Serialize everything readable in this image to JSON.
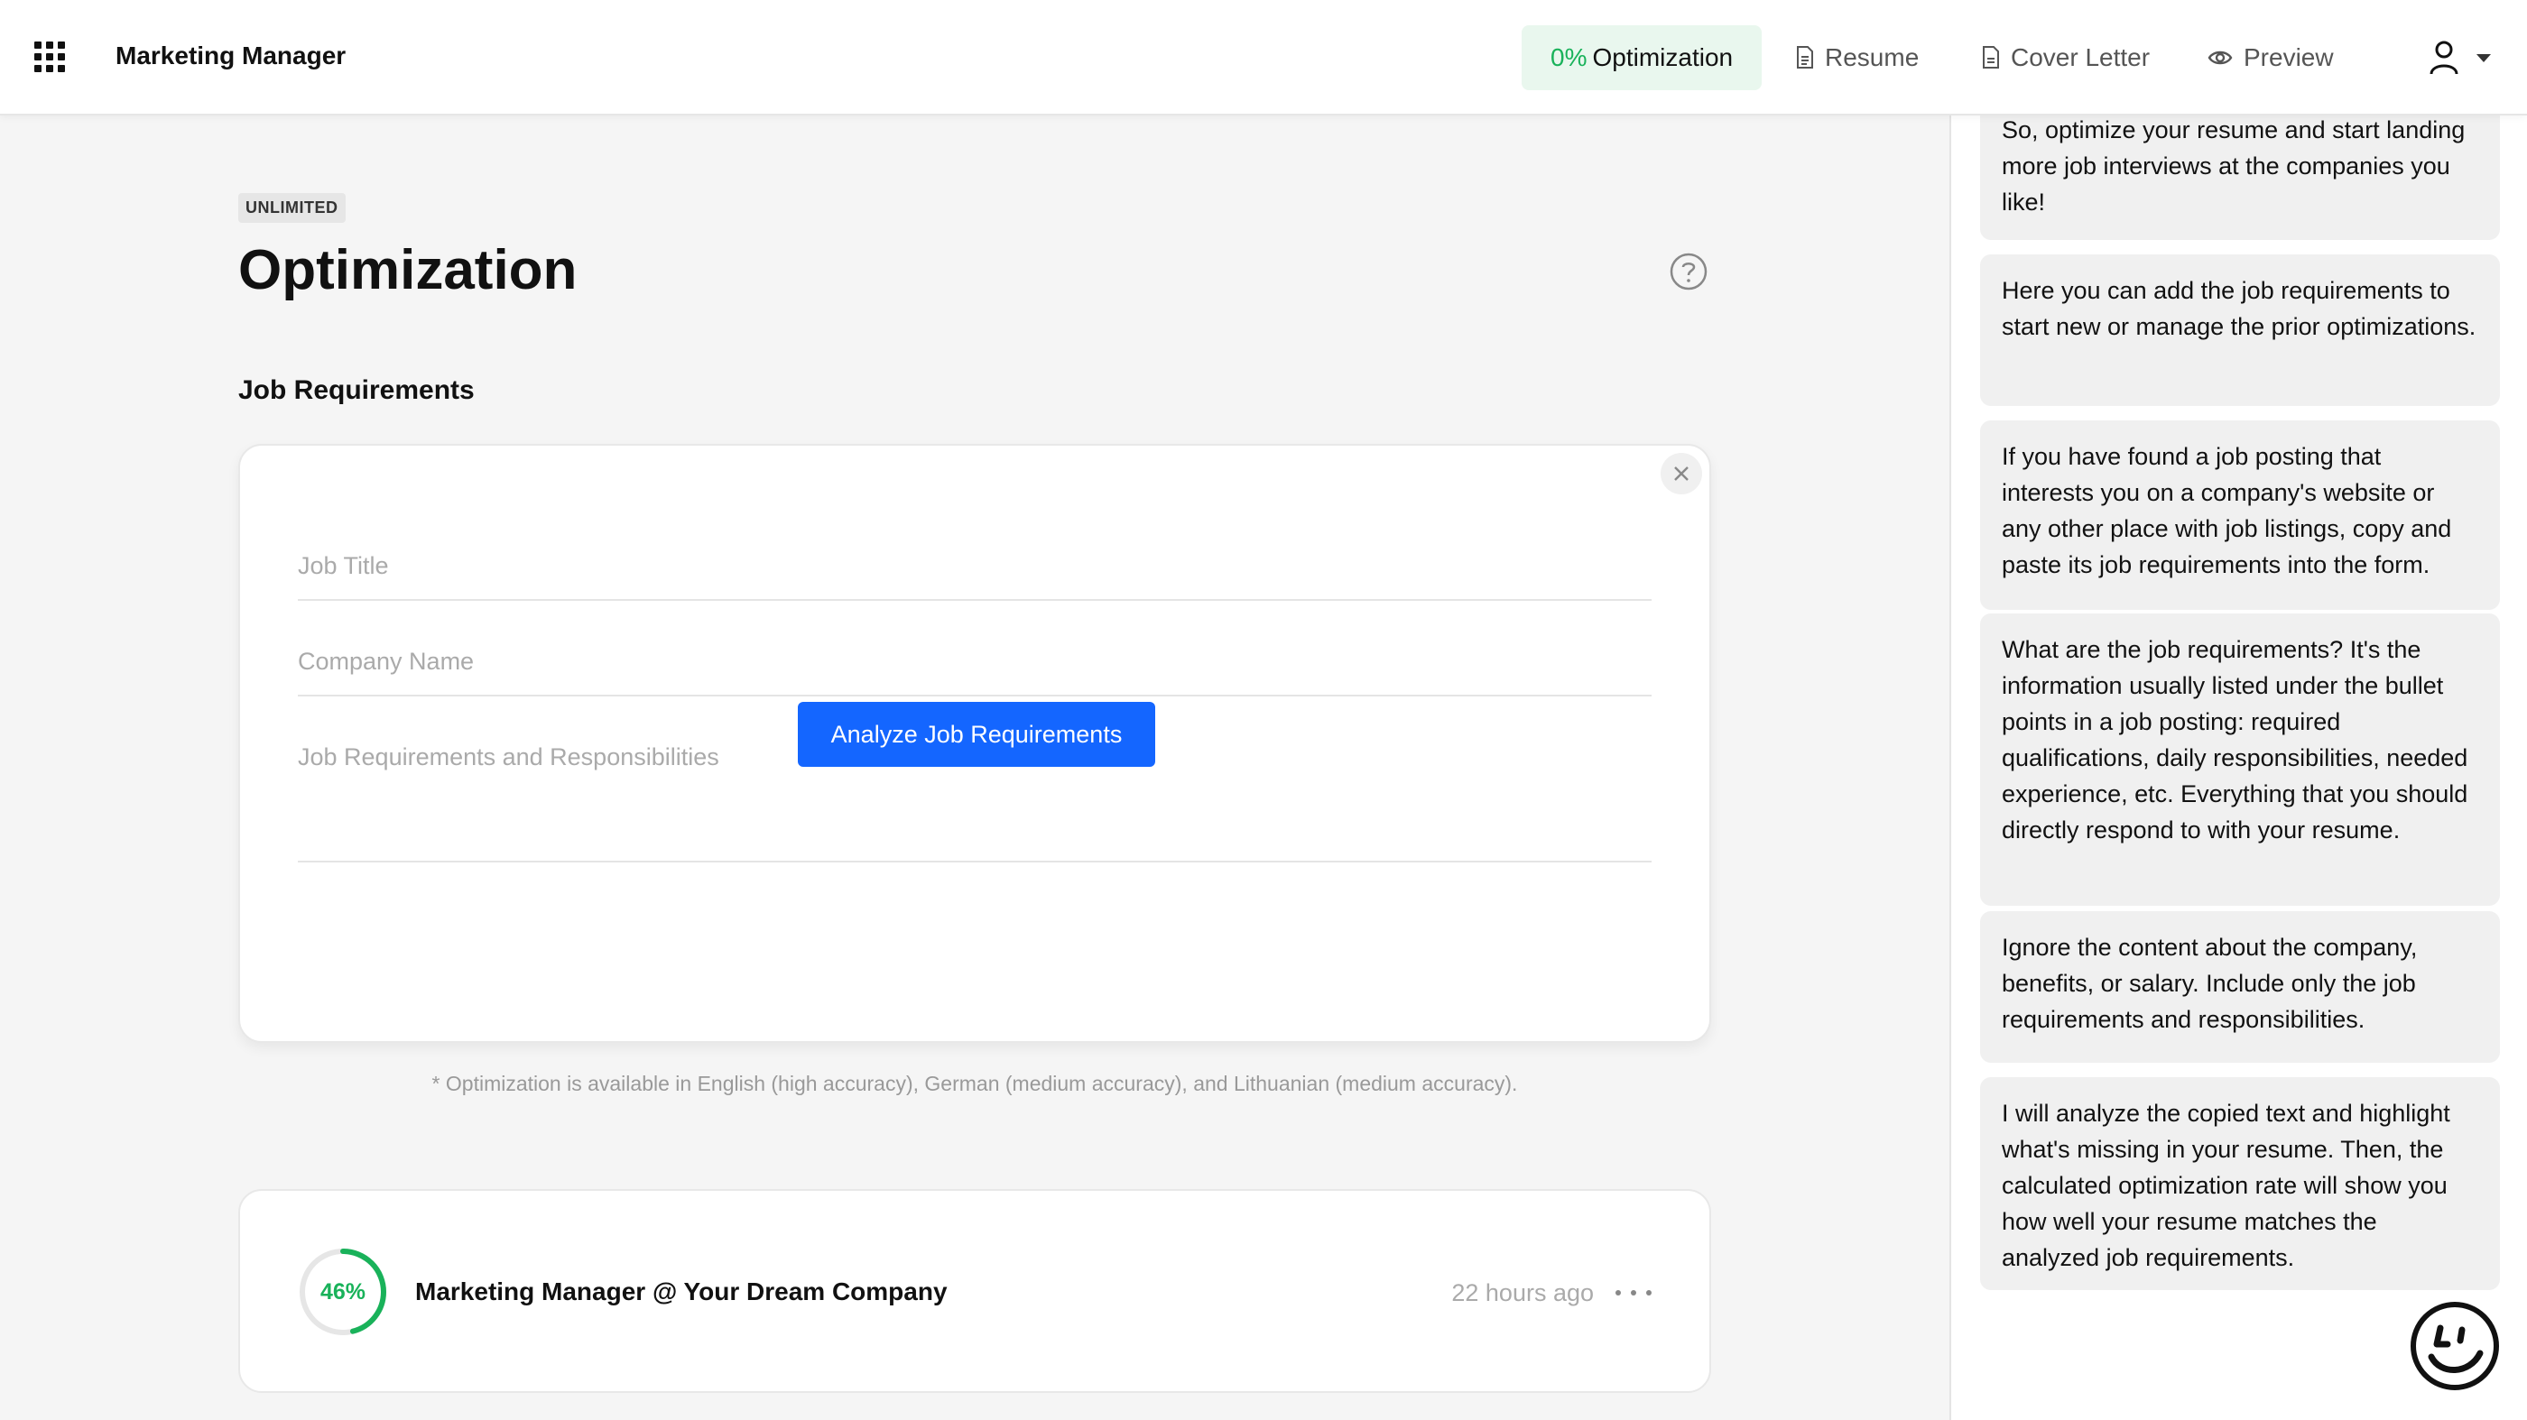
{
  "header": {
    "doc_title": "Marketing Manager",
    "tabs": [
      {
        "pct": "0%",
        "label": "Optimization",
        "icon": "optimization",
        "active": true
      },
      {
        "label": "Resume",
        "icon": "document-icon"
      },
      {
        "label": "Cover Letter",
        "icon": "document-icon"
      },
      {
        "label": "Preview",
        "icon": "eye-icon"
      }
    ],
    "user_icon": "user-icon"
  },
  "main": {
    "badge": "UNLIMITED",
    "title": "Optimization",
    "section_title": "Job Requirements",
    "form": {
      "job_title_placeholder": "Job Title",
      "company_placeholder": "Company Name",
      "requirements_placeholder": "Job Requirements and Responsibilities",
      "analyze_label": "Analyze Job Requirements"
    },
    "footnote": "* Optimization is available in English (high accuracy), German (medium accuracy), and Lithuanian (medium accuracy).",
    "history": [
      {
        "percent": 46,
        "percent_label": "46%",
        "title": "Marketing Manager @ Your Dream Company",
        "time": "22 hours ago"
      }
    ]
  },
  "side": {
    "tips": [
      "So, optimize your resume and start landing more job interviews at the companies you like!",
      "Here you can add the job requirements to start new or manage the prior optimizations.",
      "If you have found a job posting that interests you on a company's website or any other place with job listings, copy and paste its job requirements into the form.",
      "What are the job requirements? It's the information usually listed under the bullet points in a job posting: required qualifications, daily responsibilities, needed experience, etc. Everything that you should directly respond to with your resume.",
      "Ignore the content about the company, benefits, or salary. Include only the job requirements and responsibilities.",
      "I will analyze the copied text and highlight what's missing in your resume. Then, the calculated optimization rate will show you how well your resume matches the analyzed job requirements."
    ]
  },
  "colors": {
    "accent_green": "#19b25a",
    "primary_blue": "#1466ff",
    "active_tab_bg": "#e9f7ee"
  }
}
